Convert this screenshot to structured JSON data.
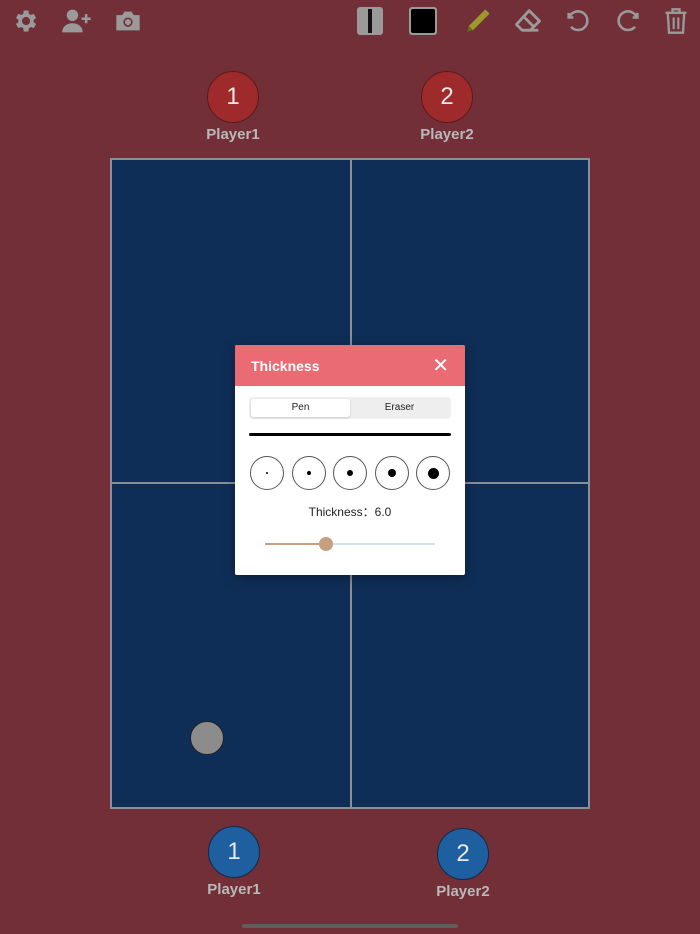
{
  "toolbar": {
    "left_icons": [
      "gear-icon",
      "add-user-icon",
      "camera-icon"
    ],
    "right_icons": [
      "line-style-icon",
      "color-swatch-icon",
      "pencil-icon",
      "eraser-icon",
      "undo-icon",
      "redo-icon",
      "trash-icon"
    ],
    "selected_color": "#000000"
  },
  "players_top": [
    {
      "number": "1",
      "name": "Player1",
      "color": "#9e2a2b"
    },
    {
      "number": "2",
      "name": "Player2",
      "color": "#9e2a2b"
    }
  ],
  "players_bottom": [
    {
      "number": "1",
      "name": "Player1",
      "color": "#1e5fa0"
    },
    {
      "number": "2",
      "name": "Player2",
      "color": "#1e5fa0"
    }
  ],
  "colors": {
    "background": "#722f37",
    "court": "#0f2e57",
    "court_lines": "#8b8f97",
    "modal_header": "#ea6b73",
    "slider_accent": "#c89f7e"
  },
  "thickness_dialog": {
    "title": "Thickness",
    "close_icon": "close-icon",
    "tabs": [
      {
        "label": "Pen",
        "active": true
      },
      {
        "label": "Eraser",
        "active": false
      }
    ],
    "presets_count": 5,
    "thickness_text": "Thickness：6.0",
    "thickness_value": 6.0,
    "slider_fraction": 0.36
  }
}
